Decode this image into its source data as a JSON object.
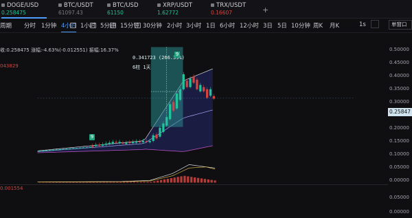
{
  "tickers": [
    {
      "symbol": "DOGE/USD",
      "price": "0.258475",
      "price_color": "#22c39a",
      "active": true
    },
    {
      "symbol": "BTC/USDT",
      "price": "61097.43",
      "price_color": "#7a7a84",
      "active": false
    },
    {
      "symbol": "BTC/USD",
      "price": "61150",
      "price_color": "#22c39a",
      "active": false
    },
    {
      "symbol": "XRP/USDT",
      "price": "1.62772",
      "price_color": "#22c39a",
      "active": false
    },
    {
      "symbol": "TRX/USDT",
      "price": "0.16607",
      "price_color": "#d4443f",
      "active": false
    }
  ],
  "toolbar": {
    "period_label": "周期",
    "timeframes": [
      "分时",
      "1分钟",
      "4小时",
      "1小时",
      "5分钟",
      "15分钟",
      "30分钟",
      "2小时",
      "3小时",
      "1日",
      "6小时",
      "12小时",
      "3日",
      "5日",
      "10分钟",
      "周K",
      "月K"
    ],
    "selected_timeframe": "4小时",
    "interval_short": "1s",
    "chart_mode": "单窗口"
  },
  "chart_info": {
    "line1": "收:0.258475 涨幅:-4.63%(-0.012551) 振幅:16.37%",
    "line2": "043829",
    "indicator": "0.001554"
  },
  "tooltip": {
    "line1": "0.341723 (266.39%)",
    "line2": "6柱 1天"
  },
  "markers": [
    "9",
    "9"
  ],
  "current_price_label": "0.25847",
  "axis": {
    "price_ticks": [
      "0.50000",
      "0.45000",
      "0.40000",
      "0.35000",
      "0.30000",
      "0.25000",
      "0.20000",
      "0.15000",
      "0.10000",
      "0.05000",
      "0.00000"
    ],
    "indicator_ticks": [
      "0.05000",
      "0.00000"
    ]
  },
  "colors": {
    "up": "#22c39a",
    "down": "#d4443f",
    "accent": "#4d9dff",
    "band_fill": "#1d1f4a",
    "measure_fill": "#2a8a8c"
  }
}
